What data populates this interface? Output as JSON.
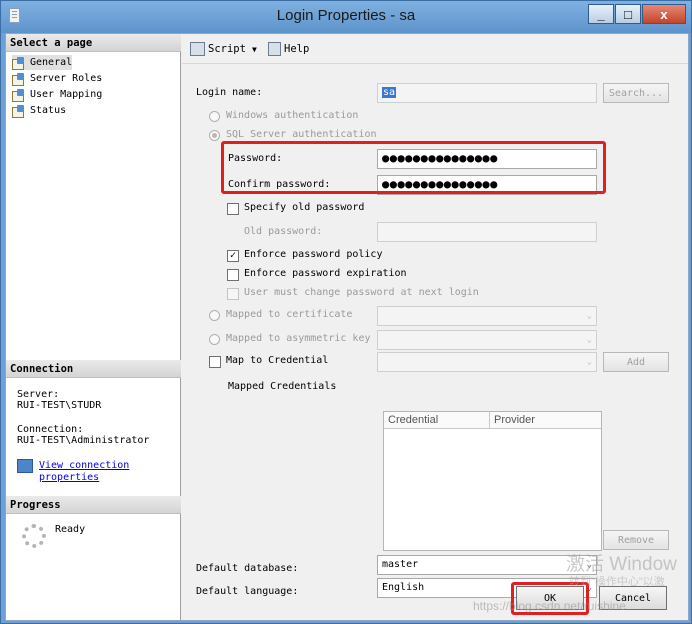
{
  "window": {
    "title": "Login Properties - sa",
    "minimize": "_",
    "maximize": "□",
    "close": "x"
  },
  "left_panel": {
    "select_page_header": "Select a page",
    "pages": [
      "General",
      "Server Roles",
      "User Mapping",
      "Status"
    ],
    "connection_header": "Connection",
    "server_label": "Server:",
    "server_value": "RUI-TEST\\STUDR",
    "connection_label": "Connection:",
    "connection_value": "RUI-TEST\\Administrator",
    "view_link_line1": "View connection",
    "view_link_line2": "properties",
    "progress_header": "Progress",
    "progress_status": "Ready"
  },
  "toolbar": {
    "script_label": "Script",
    "dropdown_arrow": "▼",
    "help_label": "Help"
  },
  "form": {
    "login_name_label": "Login name:",
    "login_name_value": "sa",
    "search_button": "Search...",
    "windows_auth": "Windows authentication",
    "sql_auth": "SQL Server authentication",
    "password_label": "Password:",
    "password_value": "●●●●●●●●●●●●●●●",
    "confirm_label": "Confirm password:",
    "confirm_value": "●●●●●●●●●●●●●●●",
    "specify_old": "Specify old password",
    "old_password_label": "Old password:",
    "enforce_policy": "Enforce password policy",
    "enforce_policy_checked": true,
    "enforce_expiration": "Enforce password expiration",
    "must_change": "User must change password at next login",
    "mapped_cert": "Mapped to certificate",
    "mapped_asym": "Mapped to asymmetric key",
    "map_credential": "Map to Credential",
    "add_button": "Add",
    "mapped_credentials_label": "Mapped Credentials",
    "grid_columns": [
      "Credential",
      "Provider"
    ],
    "remove_button": "Remove",
    "default_db_label": "Default database:",
    "default_db_value": "master",
    "default_lang_label": "Default language:",
    "default_lang_value": "English",
    "check_mark": "✓",
    "dropdown_arrow": "⌄"
  },
  "buttons": {
    "ok": "OK",
    "cancel": "Cancel"
  },
  "watermarks": {
    "activate_windows": "激活 Window",
    "activate_sub": "转到\"操作中心\"以激",
    "url": "https://blog.csdn.net/ruishine"
  },
  "colors": {
    "highlight_border": "#e02020",
    "title_bar": "#6fa0d4"
  }
}
